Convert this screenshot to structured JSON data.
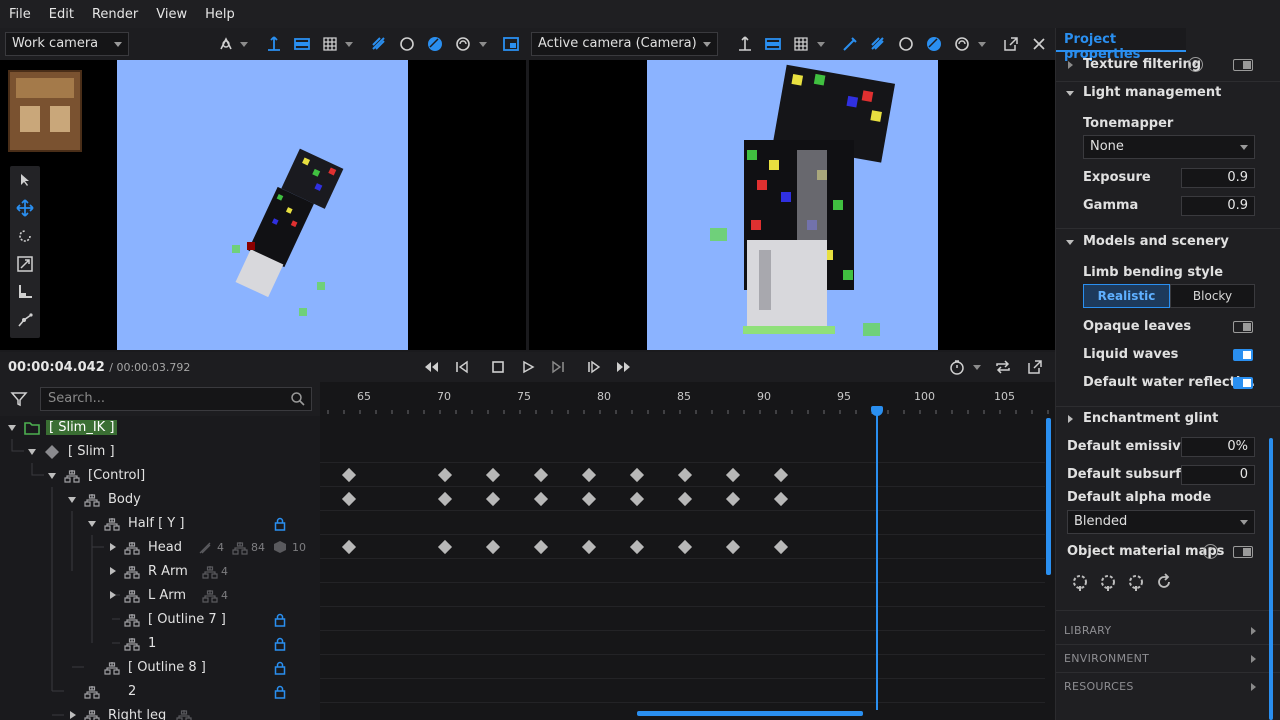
{
  "menu": [
    "File",
    "Edit",
    "Render",
    "View",
    "Help"
  ],
  "colors": {
    "accent": "#2a8ff0",
    "sky": "#8bb3ff",
    "keyframe": "#b8b8b8",
    "folder": "#4caf50"
  },
  "left_view": {
    "camera_dropdown": "Work camera"
  },
  "right_view": {
    "camera_dropdown": "Active camera (Camera)"
  },
  "transport": {
    "time_current": "00:00:04.042",
    "time_total": "/ 00:00:03.792"
  },
  "timeline_search_placeholder": "Search...",
  "ruler_ticks": [
    "65",
    "70",
    "75",
    "80",
    "85",
    "90",
    "95",
    "100",
    "105"
  ],
  "tree": [
    {
      "label": "[ Slim_IK ]"
    },
    {
      "label": "[ Slim ]"
    },
    {
      "label": "[Control]"
    },
    {
      "label": "Body"
    },
    {
      "label": "Half [ Y ]"
    },
    {
      "label": "Head",
      "meta": [
        "4",
        "84",
        "10"
      ]
    },
    {
      "label": "R Arm",
      "meta": [
        "4"
      ]
    },
    {
      "label": "L Arm",
      "meta": [
        "4"
      ]
    },
    {
      "label": "[ Outline 7 ]"
    },
    {
      "label": "1"
    },
    {
      "label": "[ Outline 8 ]"
    },
    {
      "label": "2"
    },
    {
      "label": "Right leg"
    }
  ],
  "properties": {
    "tab": "Project properties",
    "texture_filtering": "Texture filtering",
    "light_management": "Light management",
    "tonemapper_label": "Tonemapper",
    "tonemapper_value": "None",
    "exposure_label": "Exposure",
    "exposure_value": "0.9",
    "gamma_label": "Gamma",
    "gamma_value": "0.9",
    "models_scenery": "Models and scenery",
    "limb_bending_label": "Limb bending style",
    "limb_realistic": "Realistic",
    "limb_blocky": "Blocky",
    "opaque_leaves": "Opaque leaves",
    "liquid_waves": "Liquid waves",
    "default_water": "Default water reflecti...",
    "enchantment_glint": "Enchantment glint",
    "default_emissive_label": "Default emissive",
    "default_emissive_value": "0%",
    "default_subsurface_label": "Default subsurface",
    "default_subsurface_value": "0",
    "default_alpha_label": "Default alpha mode",
    "default_alpha_value": "Blended",
    "object_material_maps": "Object material maps",
    "library": "LIBRARY",
    "environment": "ENVIRONMENT",
    "resources": "RESOURCES"
  }
}
